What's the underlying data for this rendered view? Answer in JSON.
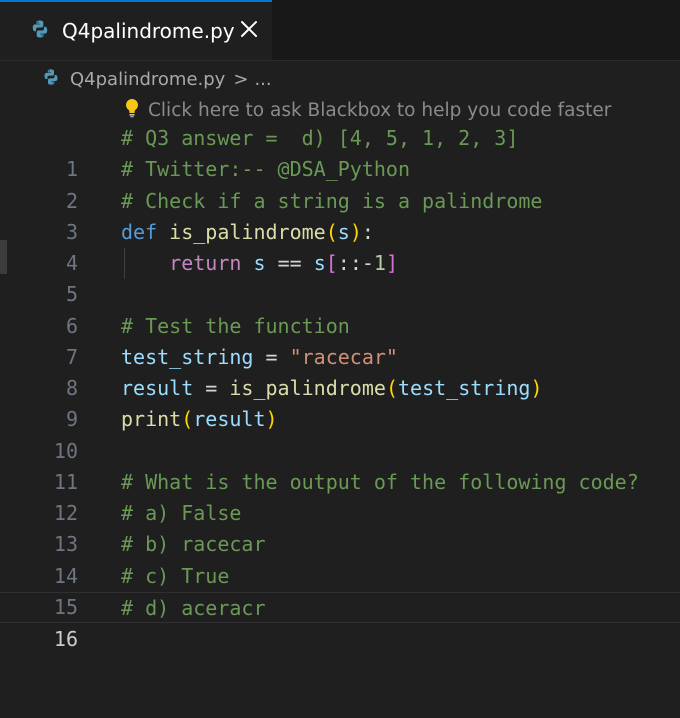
{
  "tab": {
    "filename": "Q4palindrome.py",
    "icon": "python-icon"
  },
  "breadcrumb": {
    "file": "Q4palindrome.py",
    "separator": ">",
    "more": "..."
  },
  "hint": {
    "text": "Click here to ask Blackbox to help you code faster"
  },
  "editor": {
    "current_line": 16,
    "line_numbers": [
      "1",
      "2",
      "3",
      "4",
      "5",
      "6",
      "7",
      "8",
      "9",
      "10",
      "11",
      "12",
      "13",
      "14",
      "15",
      "16"
    ],
    "lines": [
      {
        "c1": "# Q3 answer =  d) [4, 5, 1, 2, 3]"
      },
      {
        "c1": "# Twitter:-- @DSA_Python"
      },
      {
        "c1": "# Check if a string is a palindrome"
      },
      {
        "kw": "def",
        "fn": "is_palindrome",
        "po": "(",
        "arg": "s",
        "pc": ")",
        "colon": ":"
      },
      {
        "kw": "return",
        "v1": "s",
        "op": "==",
        "v2": "s",
        "bo": "[",
        "sl": "::-",
        "num": "1",
        "bc": "]"
      },
      {},
      {
        "c1": "# Test the function"
      },
      {
        "var": "test_string",
        "op": "=",
        "str": "\"racecar\""
      },
      {
        "var": "result",
        "op": "=",
        "fn": "is_palindrome",
        "po": "(",
        "arg": "test_string",
        "pc": ")"
      },
      {
        "fn": "print",
        "po": "(",
        "arg": "result",
        "pc": ")"
      },
      {},
      {
        "c1": "# What is the output of the following code?"
      },
      {
        "c1": "# a) False"
      },
      {
        "c1": "# b) racecar"
      },
      {
        "c1": "# c) True"
      },
      {
        "c1": "# d) aceracr"
      }
    ]
  }
}
